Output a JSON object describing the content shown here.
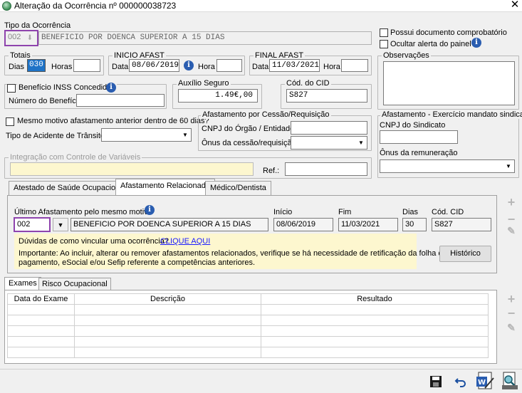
{
  "window": {
    "title": "Alteração da Ocorrência nº 000000038723"
  },
  "tipo_ocorrencia": {
    "label": "Tipo da Ocorrência",
    "code": "002",
    "description": "BENEFICIO POR DOENCA SUPERIOR A 15 DIAS"
  },
  "options": {
    "possui_documento": "Possui documento comprobatório",
    "ocultar_alerta": "Ocultar alerta do painel"
  },
  "totais": {
    "legend": "Totais",
    "dias_label": "Dias",
    "dias_value": "030",
    "horas_label": "Horas",
    "horas_value": ""
  },
  "inicio_afast": {
    "legend": "INICIO AFAST",
    "data_label": "Data",
    "data_value": "08/06/2019",
    "hora_label": "Hora",
    "hora_value": ""
  },
  "final_afast": {
    "legend": "FINAL AFAST",
    "data_label": "Data",
    "data_value": "11/03/2021",
    "hora_label": "Hora",
    "hora_value": ""
  },
  "observacoes": {
    "legend": "Observações",
    "value": ""
  },
  "beneficio": {
    "checkbox_label": "Benefício INSS Concedido?",
    "numero_label": "Número do Benefício:",
    "numero_value": ""
  },
  "auxilio_seguro": {
    "legend": "Auxílio Seguro",
    "value": "1.49€,00"
  },
  "cod_cid": {
    "legend": "Cód. do CID",
    "value": "S827"
  },
  "mesmo_motivo": {
    "label": "Mesmo motivo afastamento anterior dentro de 60 dias?"
  },
  "acidente_transito": {
    "label": "Tipo de Acidente de Trânsito:",
    "value": ""
  },
  "cessao": {
    "legend": "Afastamento por Cessão/Requisição",
    "cnpj_label": "CNPJ do Órgão / Entidade:",
    "cnpj_value": "",
    "onus_label": "Ônus da cessão/requisição:",
    "onus_value": ""
  },
  "mandato_sindical": {
    "legend": "Afastamento - Exercício mandato sindical",
    "cnpj_label": "CNPJ do Sindicato",
    "cnpj_value": "",
    "onus_label": "Ônus da remuneração",
    "onus_value": ""
  },
  "integracao": {
    "legend": "Integração com Controle de Variáveis",
    "value": "",
    "ref_label": "Ref.:",
    "ref_value": ""
  },
  "tabs": [
    {
      "label": "Atestado de Saúde Ocupacional"
    },
    {
      "label": "Afastamento Relacionado"
    },
    {
      "label": "Médico/Dentista"
    }
  ],
  "relacionado": {
    "ultimo_label": "Último Afastamento pelo mesmo motivo",
    "code": "002",
    "description": "BENEFICIO POR DOENCA SUPERIOR A 15 DIAS",
    "inicio_label": "Início",
    "inicio_value": "08/06/2019",
    "fim_label": "Fim",
    "fim_value": "11/03/2021",
    "dias_label": "Dias",
    "dias_value": "30",
    "cid_label": "Cód. CID",
    "cid_value": "S827",
    "duvidas_text": "Dúvidas de como vincular uma ocorrência?",
    "clique_aqui": "CLIQUE AQUI",
    "importante_line1": "Importante: Ao incluir, alterar ou remover afastamentos relacionados, verifique se há necessidade de retificação da folha de",
    "importante_line2": "pagamento, eSocial e/ou Sefip referente a competências anteriores.",
    "historico_button": "Histórico"
  },
  "bottom_tabs": [
    {
      "label": "Exames"
    },
    {
      "label": "Risco Ocupacional"
    }
  ],
  "exames_table": {
    "columns": [
      "Data do Exame",
      "Descrição",
      "Resultado"
    ]
  },
  "icons": {
    "add": "plus-icon",
    "remove": "minus-icon",
    "edit": "pencil-icon",
    "save": "floppy-disk-icon",
    "undo": "undo-icon"
  }
}
